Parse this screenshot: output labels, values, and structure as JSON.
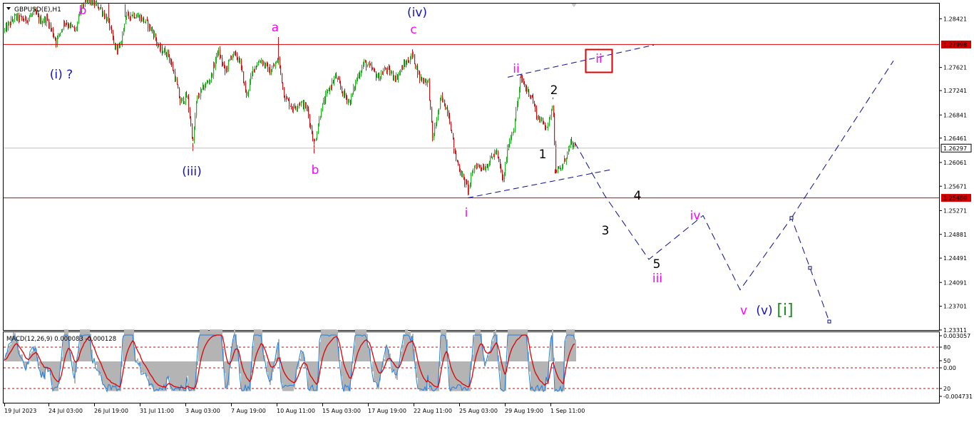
{
  "symbol": "GBPUSD(E),H1",
  "indicator_label": "MACD(12,26,9) 0.000083 -0.000128",
  "colors": {
    "wave_blue": "#1515b8",
    "wave_magenta": "#ff00ff",
    "wave_green": "#1e8a1e",
    "wave_black": "#000000",
    "level_line": "#d40000",
    "projection": "#0a0a96",
    "candle_bull": "#1faf1f",
    "candle_bear": "#c81414",
    "macd_signal": "#e00000",
    "macd_main": "#1e7fe0",
    "histogram": "#b4b4b4"
  },
  "price_axis": {
    "ticks": [
      "1.28421",
      "1.27998",
      "1.27621",
      "1.27241",
      "1.26841",
      "1.26461",
      "1.26297",
      "1.26061",
      "1.25671",
      "1.25480",
      "1.25271",
      "1.24881",
      "1.24491",
      "1.24091",
      "1.23701",
      "1.23311"
    ],
    "highlighted": [
      "1.27998",
      "1.25480"
    ],
    "current": "1.26297"
  },
  "macd_axis": {
    "ticks": [
      "0.003057",
      "80",
      "50",
      "0.00",
      "20",
      "-0.004731"
    ]
  },
  "time_axis": {
    "labels": [
      "19 Jul 2023",
      "24 Jul 03:00",
      "26 Jul 19:00",
      "31 Jul 11:00",
      "3 Aug 03:00",
      "7 Aug 19:00",
      "10 Aug 11:00",
      "15 Aug 03:00",
      "17 Aug 19:00",
      "22 Aug 11:00",
      "25 Aug 03:00",
      "29 Aug 19:00",
      "1 Sep 11:00"
    ]
  },
  "wave_labels": {
    "b_top": "b",
    "i_q": "(i) ?",
    "a": "a",
    "iv": "(iv)",
    "c": "c",
    "iii_paren": "(iii)",
    "b_low": "b",
    "ii_small": "ii",
    "ii_box": "ii",
    "two": "2",
    "one": "1",
    "i_small": "i",
    "four": "4",
    "three": "3",
    "iv_small": "iv",
    "five": "5",
    "iii_small": "iii",
    "v_small": "v",
    "v_paren": "(v)",
    "i_bracket": "[i]"
  },
  "chart_data": {
    "type": "candlestick",
    "title": "GBPUSD(E),H1",
    "ylim": [
      1.2331,
      1.2867
    ],
    "levels": [
      1.27998,
      1.2548
    ],
    "current_price": 1.26297,
    "price_path": [
      [
        5,
        1.2822
      ],
      [
        20,
        1.2845
      ],
      [
        35,
        1.284
      ],
      [
        48,
        1.2852
      ],
      [
        56,
        1.2838
      ],
      [
        65,
        1.2842
      ],
      [
        78,
        1.2805
      ],
      [
        90,
        1.2838
      ],
      [
        105,
        1.2822
      ],
      [
        115,
        1.2865
      ],
      [
        125,
        1.2872
      ],
      [
        140,
        1.286
      ],
      [
        152,
        1.2835
      ],
      [
        160,
        1.2795
      ],
      [
        168,
        1.2795
      ],
      [
        175,
        1.2845
      ],
      [
        185,
        1.285
      ],
      [
        195,
        1.2845
      ],
      [
        205,
        1.2835
      ],
      [
        215,
        1.2818
      ],
      [
        222,
        1.2793
      ],
      [
        235,
        1.2785
      ],
      [
        245,
        1.2745
      ],
      [
        252,
        1.2705
      ],
      [
        262,
        1.2715
      ],
      [
        270,
        1.2638
      ],
      [
        275,
        1.271
      ],
      [
        285,
        1.273
      ],
      [
        295,
        1.2745
      ],
      [
        305,
        1.279
      ],
      [
        315,
        1.2755
      ],
      [
        325,
        1.2785
      ],
      [
        335,
        1.2775
      ],
      [
        345,
        1.2715
      ],
      [
        355,
        1.2762
      ],
      [
        365,
        1.2775
      ],
      [
        378,
        1.2755
      ],
      [
        390,
        1.2775
      ],
      [
        398,
        1.2715
      ],
      [
        410,
        1.2695
      ],
      [
        420,
        1.2705
      ],
      [
        430,
        1.2695
      ],
      [
        440,
        1.2635
      ],
      [
        450,
        1.2695
      ],
      [
        460,
        1.2725
      ],
      [
        470,
        1.2748
      ],
      [
        480,
        1.272
      ],
      [
        490,
        1.2705
      ],
      [
        500,
        1.2745
      ],
      [
        510,
        1.277
      ],
      [
        520,
        1.276
      ],
      [
        530,
        1.2745
      ],
      [
        540,
        1.276
      ],
      [
        555,
        1.2745
      ],
      [
        565,
        1.2765
      ],
      [
        578,
        1.2782
      ],
      [
        588,
        1.2745
      ],
      [
        600,
        1.2738
      ],
      [
        606,
        1.2645
      ],
      [
        618,
        1.2712
      ],
      [
        628,
        1.269
      ],
      [
        638,
        1.2615
      ],
      [
        648,
        1.2582
      ],
      [
        656,
        1.2562
      ],
      [
        665,
        1.2602
      ],
      [
        680,
        1.2598
      ],
      [
        695,
        1.2625
      ],
      [
        705,
        1.2575
      ],
      [
        712,
        1.2635
      ],
      [
        720,
        1.2665
      ],
      [
        730,
        1.2745
      ],
      [
        738,
        1.2725
      ],
      [
        745,
        1.2715
      ],
      [
        752,
        1.2682
      ],
      [
        760,
        1.2672
      ],
      [
        768,
        1.2665
      ],
      [
        775,
        1.271
      ],
      [
        778,
        1.2595
      ],
      [
        785,
        1.2592
      ],
      [
        792,
        1.2612
      ],
      [
        800,
        1.2638
      ],
      [
        806,
        1.2628
      ]
    ],
    "projection_path": [
      [
        806,
        1.2639
      ],
      [
        848,
        1.2552
      ],
      [
        910,
        1.2447
      ],
      [
        986,
        1.2519
      ],
      [
        1038,
        1.2397
      ],
      [
        1110,
        1.2515
      ],
      [
        1136,
        1.2433
      ],
      [
        1163,
        1.2345
      ]
    ],
    "projection_targets": [
      1.2515,
      1.2433,
      1.2345
    ],
    "projection_rally": [
      [
        1110,
        1.2515
      ],
      [
        1253,
        1.2773
      ]
    ],
    "channel_upper": [
      [
        712,
        1.2746
      ],
      [
        917,
        1.2799
      ]
    ],
    "channel_lower": [
      [
        656,
        1.2548
      ],
      [
        860,
        1.2595
      ]
    ],
    "macd": {
      "ylim": [
        -0.004731,
        0.003057
      ],
      "levels": [
        80,
        50,
        20
      ]
    }
  }
}
